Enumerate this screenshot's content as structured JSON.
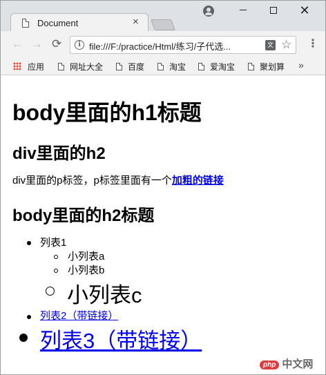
{
  "browser": {
    "tab_title": "Document",
    "tab_close": "×",
    "url": "file:///F:/practice/Html/练习/子代选...",
    "bookmarks": [
      {
        "label": "应用",
        "icon": "apps-icon"
      },
      {
        "label": "网址大全",
        "icon": "page-icon"
      },
      {
        "label": "百度",
        "icon": "page-icon"
      },
      {
        "label": "淘宝",
        "icon": "page-icon"
      },
      {
        "label": "爱淘宝",
        "icon": "page-icon"
      },
      {
        "label": "聚划算",
        "icon": "page-icon"
      }
    ],
    "bookmarks_overflow": "»",
    "translate_glyph": "文",
    "window_close": "✕"
  },
  "page": {
    "h1": "body里面的h1标题",
    "div_h2": "div里面的h2",
    "paragraph_text": "div里面的p标签，p标签里面有一个",
    "paragraph_link": "加粗的链接",
    "body_h2": "body里面的h2标题",
    "list_item_1": "列表1",
    "sub_items": [
      "小列表a",
      "小列表b",
      "小列表c"
    ],
    "list_item_2": "列表2（带链接）",
    "list_item_3": "列表3（带链接）"
  },
  "watermark": {
    "logo": "php",
    "text": "中文网"
  }
}
